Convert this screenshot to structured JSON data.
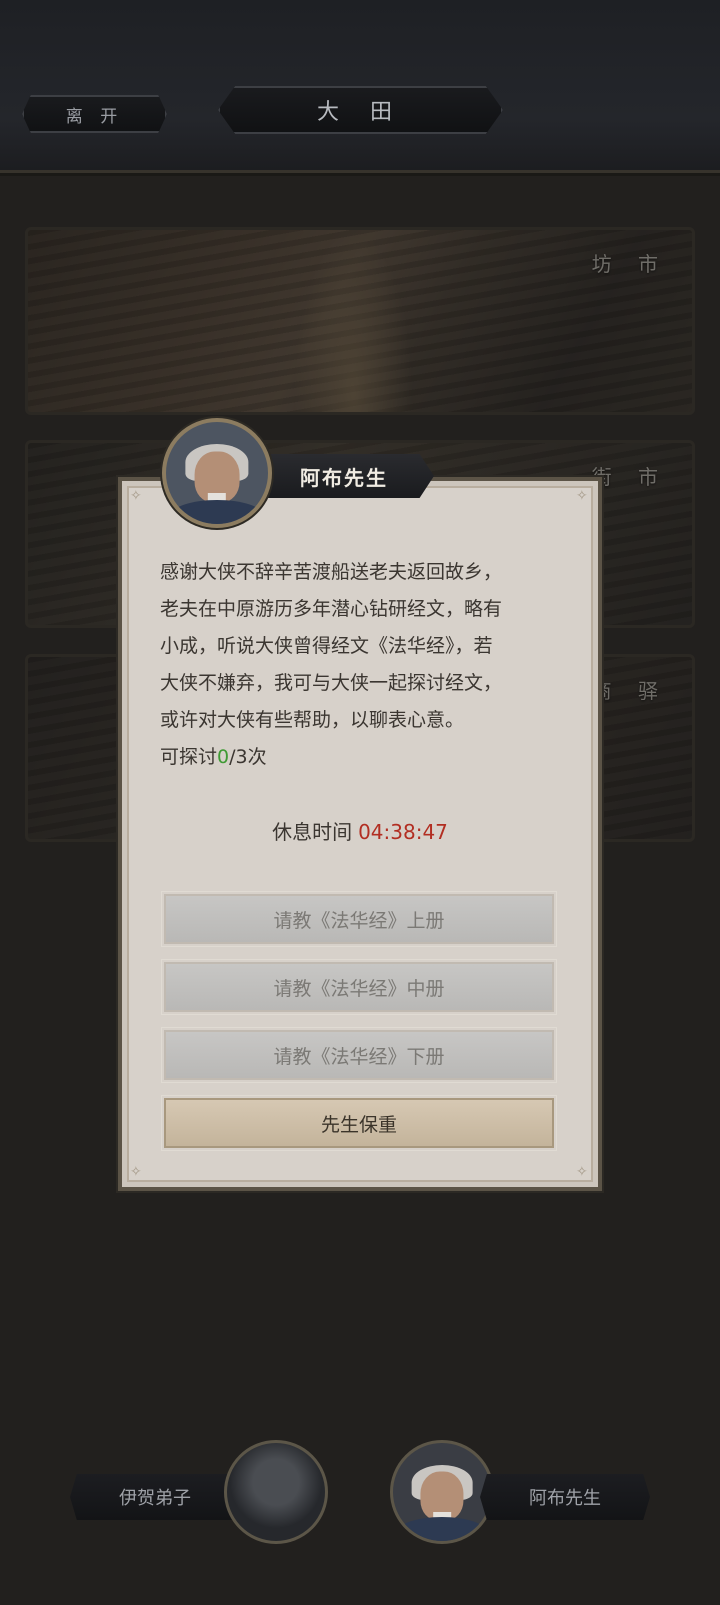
{
  "header": {
    "leave_label": "离 开",
    "title": "大 田"
  },
  "locations": [
    {
      "label": "坊 市"
    },
    {
      "label": "街 市"
    },
    {
      "label": "商 驿"
    }
  ],
  "dialog": {
    "speaker": "阿布先生",
    "lines": [
      "感谢大侠不辞辛苦渡船送老夫返回故乡，",
      "老夫在中原游历多年潜心钻研经文，略有",
      "小成，听说大侠曾得经文《法华经》，若",
      "大侠不嫌弃，我可与大侠一起探讨经文，",
      "或许对大侠有些帮助，以聊表心意。"
    ],
    "discuss_prefix": "可探讨",
    "discuss_count": "0",
    "discuss_suffix": "/3次",
    "rest_label": "休息时间",
    "rest_timer": "04:38:47",
    "buttons": {
      "vol1": "请教《法华经》上册",
      "vol2": "请教《法华经》中册",
      "vol3": "请教《法华经》下册",
      "farewell": "先生保重"
    }
  },
  "npcs": {
    "left": "伊贺弟子",
    "right": "阿布先生"
  },
  "colors": {
    "green_count": "#3f9a34",
    "timer_red": "#b22e22"
  }
}
